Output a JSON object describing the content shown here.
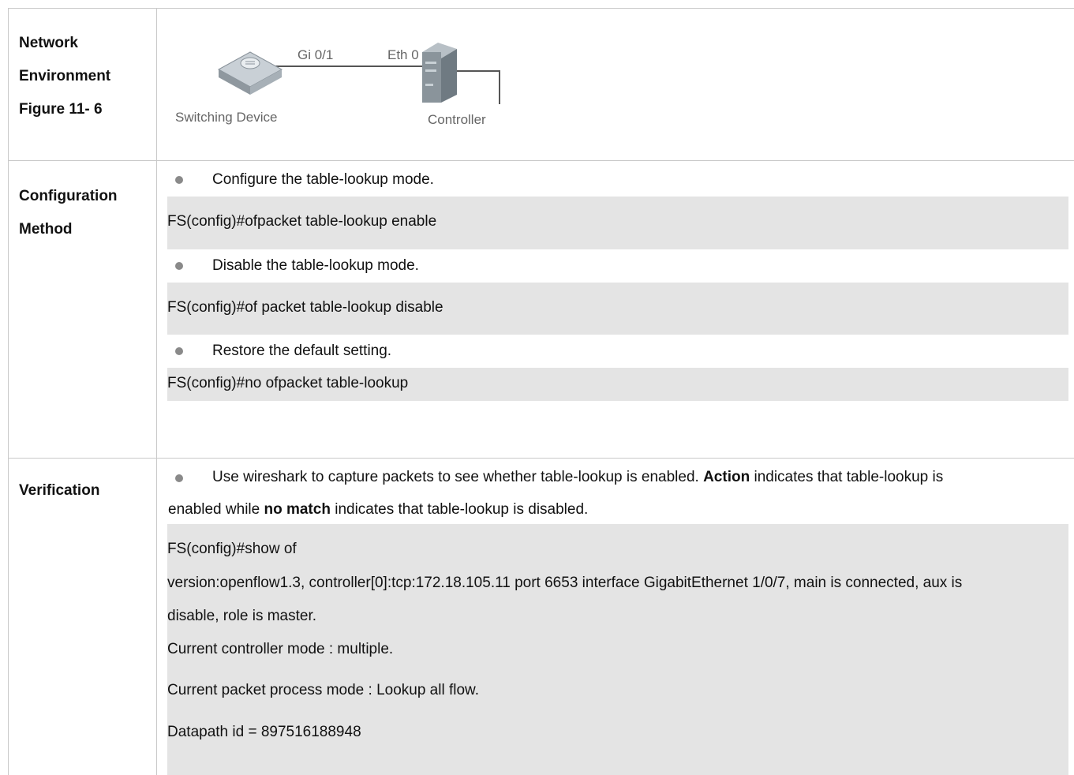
{
  "rows": {
    "network": {
      "label_lines": [
        "Network",
        "Environment",
        "Figure 11- 6"
      ],
      "figure": {
        "port_left": "Gi 0/1",
        "port_right": "Eth 0",
        "device_left": "Switching Device",
        "device_right": "Controller"
      }
    },
    "config": {
      "label_lines": [
        "Configuration",
        "Method"
      ],
      "bullet1": "Configure the table-lookup mode.",
      "code1": "FS(config)#ofpacket table-lookup enable",
      "bullet2": "Disable the table-lookup mode.",
      "code2": "FS(config)#of packet table-lookup disable",
      "bullet3": "Restore the default setting.",
      "code3": "FS(config)#no ofpacket table-lookup"
    },
    "verify": {
      "label_lines": [
        "Verification"
      ],
      "intro_part1": "Use wireshark to capture packets to see whether table-lookup is enabled.",
      "intro_bold1": "Action",
      "intro_part2": "indicates that table-lookup is",
      "intro_part3": "enabled while",
      "intro_bold2": "no match",
      "intro_part4": "indicates that table-lookup is disabled.",
      "code_lines": [
        "FS(config)#show of",
        "version:openflow1.3, controller[0]:tcp:172.18.105.11 port 6653 interface GigabitEthernet 1/0/7, main is connected, aux is",
        "disable, role is master.",
        "Current controller mode : multiple.",
        "Current packet process mode : Lookup all flow.",
        "Datapath id = 897516188948"
      ]
    }
  }
}
